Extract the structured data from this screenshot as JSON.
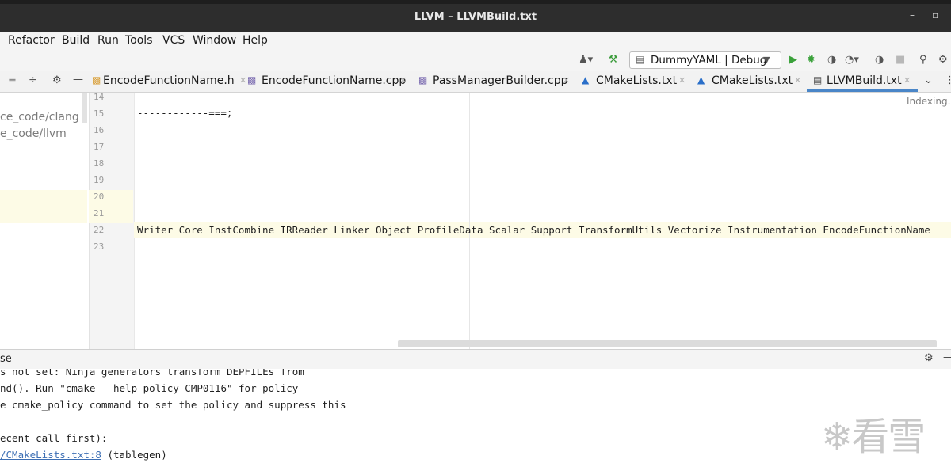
{
  "window": {
    "title": "LLVM – LLVMBuild.txt",
    "minimize": "–",
    "restore": "▫"
  },
  "menu": [
    "Refactor",
    "Build",
    "Run",
    "Tools",
    "VCS",
    "Window",
    "Help"
  ],
  "toolbar": {
    "config_label": "DummyYAML | Debug",
    "icons": [
      "user-icon",
      "hammer-icon",
      "run-icon",
      "debug-icon",
      "coverage-icon",
      "profile-icon",
      "attach-icon",
      "stop-icon",
      "search-icon",
      "settings-icon"
    ]
  },
  "tabs": [
    {
      "label": "EncodeFunctionName.h",
      "icon": "header-file-icon",
      "active": false
    },
    {
      "label": "EncodeFunctionName.cpp",
      "icon": "cpp-file-icon",
      "active": false
    },
    {
      "label": "PassManagerBuilder.cpp",
      "icon": "cpp-file-icon",
      "active": false
    },
    {
      "label": "CMakeLists.txt",
      "icon": "cmake-icon",
      "active": false
    },
    {
      "label": "CMakeLists.txt",
      "icon": "cmake-icon",
      "active": false
    },
    {
      "label": "LLVMBuild.txt",
      "icon": "text-file-icon",
      "active": true
    }
  ],
  "project": {
    "items": [
      "ce_code/clang",
      "e_code/llvm"
    ]
  },
  "editor": {
    "status": "Indexing...",
    "line_numbers": [
      "14",
      "15",
      "16",
      "17",
      "18",
      "19",
      "20",
      "21",
      "22",
      "23"
    ],
    "lines": {
      "15": "------------===;",
      "22": "Writer Core InstCombine IRReader Linker Object ProfileData Scalar Support TransformUtils Vectorize Instrumentation EncodeFunctionName"
    }
  },
  "bottom": {
    "title": "se",
    "console": [
      "s not set: Ninja generators transform DEPFILEs from",
      "nd().  Run \"cmake --help-policy CMP0116\" for policy",
      "e cmake_policy command to set the policy and suppress this",
      "",
      "ecent call first):",
      {
        "link": "/CMakeLists.txt:8",
        "rest": " (tablegen)"
      }
    ]
  },
  "watermark": "看雪",
  "colors": {
    "accent": "#4a86c8",
    "current_line": "#fdfbe6",
    "link": "#3d6fb4"
  }
}
